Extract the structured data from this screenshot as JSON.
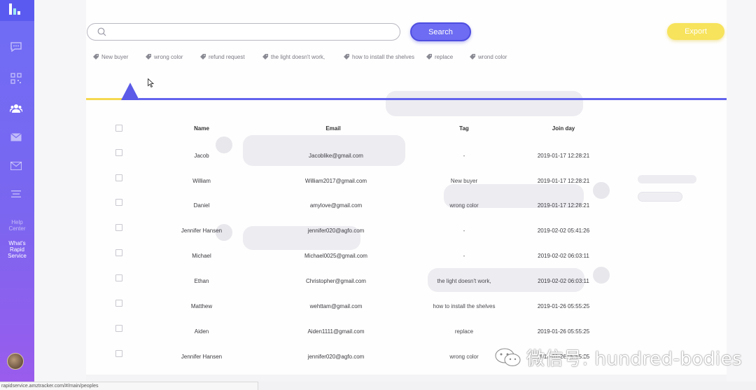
{
  "sidebar": {
    "icons": [
      "logo-icon",
      "chat-icon",
      "qr-icon",
      "people-icon",
      "mail-icon",
      "mail-icon",
      "menu-icon"
    ],
    "help_label": "Help\nCenter",
    "whats_label": "What's\nRapid\nService"
  },
  "search": {
    "placeholder": "",
    "value": "",
    "button_label": "Search"
  },
  "export_label": "Export",
  "tags": [
    "New buyer",
    "wrong color",
    "refund request",
    "the light doesn't work,",
    "how to install the shelves",
    "replace",
    "wrond color"
  ],
  "table": {
    "headers": [
      "Name",
      "Email",
      "Tag",
      "Join day"
    ],
    "rows": [
      {
        "name": "Jacob",
        "email": "Jacoblike@gmail.com",
        "tag": "-",
        "join": "2019-01-17 12:28:21"
      },
      {
        "name": "William",
        "email": "William2017@gmail.com",
        "tag": "New buyer",
        "join": "2019-01-17 12:28:21"
      },
      {
        "name": "Daniel",
        "email": "amylove@gmail.com",
        "tag": "wrong color",
        "join": "2019-01-17 12:28:21"
      },
      {
        "name": "Jennifer Hansen",
        "email": "jennifer020@agfo.com",
        "tag": "-",
        "join": "2019-02-02 05:41:26"
      },
      {
        "name": "Michael",
        "email": "Michael0025@gmail.com",
        "tag": "-",
        "join": "2019-02-02 06:03:11"
      },
      {
        "name": "Ethan",
        "email": "Christopher@gmail.com",
        "tag": "the light doesn't work,",
        "join": "2019-02-02 06:03:11"
      },
      {
        "name": "Matthew",
        "email": "wehttam@gmail.com",
        "tag": "how to install the shelves",
        "join": "2019-01-26 05:55:25"
      },
      {
        "name": "Aiden",
        "email": "Aiden1111@gmail.com",
        "tag": "replace",
        "join": "2019-01-26 05:55:25"
      },
      {
        "name": "Jennifer Hansen",
        "email": "jennifer020@agfo.com",
        "tag": "wrong color",
        "join": "2019-01-26 05:55:25"
      }
    ]
  },
  "status_url": "rapidservice.amztracker.com/#/main/peoples",
  "watermark": "微信号: hundred-bodies",
  "colors": {
    "accent": "#6d6cf2",
    "export": "#f7e35c",
    "sidebar_top": "#6f6df5",
    "sidebar_bottom": "#9a5cec"
  }
}
